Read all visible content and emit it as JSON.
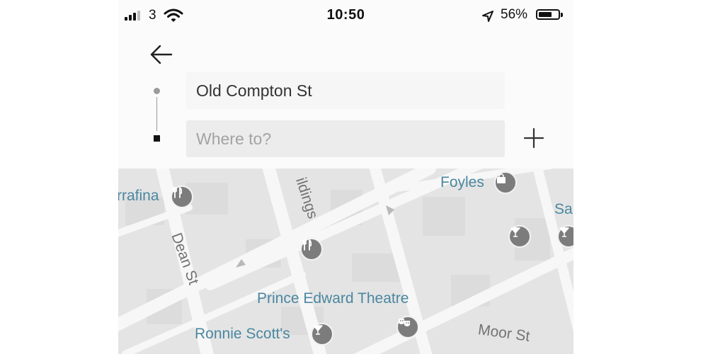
{
  "status_bar": {
    "carrier": "3",
    "time": "10:50",
    "battery": "56%"
  },
  "search": {
    "origin_value": "Old Compton St",
    "destination_placeholder": "Where to?"
  },
  "map": {
    "labels": {
      "darrafina": "rrafina",
      "foyles": "Foyles",
      "buildings": "ildings",
      "sa": "Sa",
      "dean_st": "Dean St",
      "prince_edward": "Prince Edward Theatre",
      "ronnie_scotts": "Ronnie Scott's",
      "moor_st": "Moor St"
    }
  },
  "icons": {
    "back": "back-arrow-icon",
    "add": "plus-icon",
    "restaurant": "fork-knife-icon",
    "bar": "cocktail-icon",
    "shopping": "shopping-bag-icon",
    "theatre": "theatre-masks-icon"
  },
  "colors": {
    "map_bg": "#e4e4e4",
    "road": "#f7f7f7",
    "poi_label": "#4a87a0",
    "poi_badge": "#7c7c7c"
  }
}
